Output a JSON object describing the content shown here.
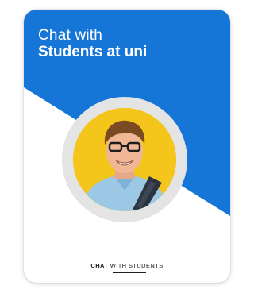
{
  "header": {
    "line1": "Chat with",
    "line2": "Students at uni"
  },
  "footer": {
    "label_bold": "CHAT",
    "label_normal": "WITH STUDENTS"
  },
  "avatar": {
    "icon": "student-portrait"
  },
  "colors": {
    "brand_blue": "#1576d8",
    "avatar_bg": "#f4c51a",
    "ring": "#e4e4e4",
    "text_dark": "#1a1a1a"
  }
}
